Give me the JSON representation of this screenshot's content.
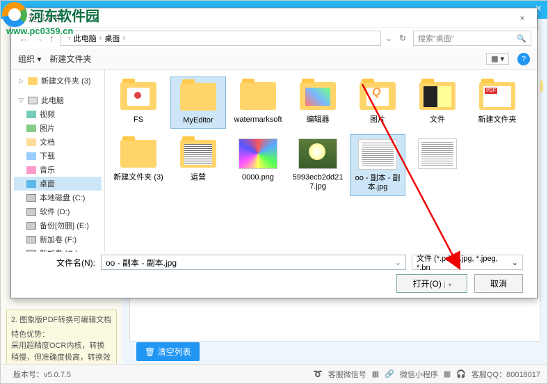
{
  "watermark": {
    "title": "河东软件园",
    "url": "www.pc0359.cn"
  },
  "bg": {
    "close": "×",
    "sidebar_title": "2. 图象版PDF转换可编辑文档",
    "sidebar_sub": "特色优势：",
    "sidebar_body": "采用超精度OCR内核，转换稍慢，但准确度极高，转换效果几乎和原件一模一样",
    "clear_btn": "清空列表",
    "version_label": "版本号：v5.0.7.5",
    "footer_wechat": "客服微信号",
    "footer_mini": "微信小程序",
    "footer_qq": "客服QQ：80018017"
  },
  "dialog": {
    "title": "选择文件",
    "breadcrumb": [
      "",
      "此电脑",
      "桌面"
    ],
    "search_placeholder": "搜索\"桌面\"",
    "organize": "组织 ▾",
    "newfolder": "新建文件夹",
    "tree": [
      {
        "label": "新建文件夹 (3)",
        "icon": "ic-folder",
        "root": true,
        "caret": "▷"
      },
      {
        "label": "此电脑",
        "icon": "ic-pc",
        "root": true,
        "caret": "▽",
        "gap": true
      },
      {
        "label": "视频",
        "icon": "ic-v"
      },
      {
        "label": "图片",
        "icon": "ic-img"
      },
      {
        "label": "文档",
        "icon": "ic-doc"
      },
      {
        "label": "下载",
        "icon": "ic-dl"
      },
      {
        "label": "音乐",
        "icon": "ic-mus"
      },
      {
        "label": "桌面",
        "icon": "ic-desk",
        "selected": true
      },
      {
        "label": "本地磁盘 (C:)",
        "icon": "ic-disk"
      },
      {
        "label": "软件 (D:)",
        "icon": "ic-disk"
      },
      {
        "label": "备份[勿删] (E:)",
        "icon": "ic-disk"
      },
      {
        "label": "新加卷 (F:)",
        "icon": "ic-disk"
      },
      {
        "label": "新加卷 (G:)",
        "icon": "ic-disk"
      }
    ],
    "files": [
      {
        "label": "FS",
        "type": "folder",
        "inner": "dot"
      },
      {
        "label": "MyEditor",
        "type": "folder",
        "sel": true
      },
      {
        "label": "watermarksoft",
        "type": "folder"
      },
      {
        "label": "编辑器",
        "type": "folder",
        "inner": "grad"
      },
      {
        "label": "图片",
        "type": "folder",
        "inner": "q"
      },
      {
        "label": "文件",
        "type": "folder",
        "inner": "bw"
      },
      {
        "label": "新建文件夹",
        "type": "folder",
        "inner": "pdf"
      },
      {
        "label": "新建文件夹 (3)",
        "type": "folder"
      },
      {
        "label": "运营",
        "type": "folder",
        "inner": "txt"
      },
      {
        "label": "0000.png",
        "type": "img-grid"
      },
      {
        "label": "5993ecb2dd217.jpg",
        "type": "img-photo"
      },
      {
        "label": "oo - 副本 - 副本.jpg",
        "type": "img-doc",
        "sel": true
      },
      {
        "label": "",
        "type": "img-doc"
      }
    ],
    "filename_label": "文件名(N):",
    "filename_value": "oo - 副本 - 副本.jpg",
    "filter": "文件 (*.pdf, *.jpg, *.jpeg, *.bn",
    "open_btn": "打开(O)",
    "cancel_btn": "取消"
  }
}
